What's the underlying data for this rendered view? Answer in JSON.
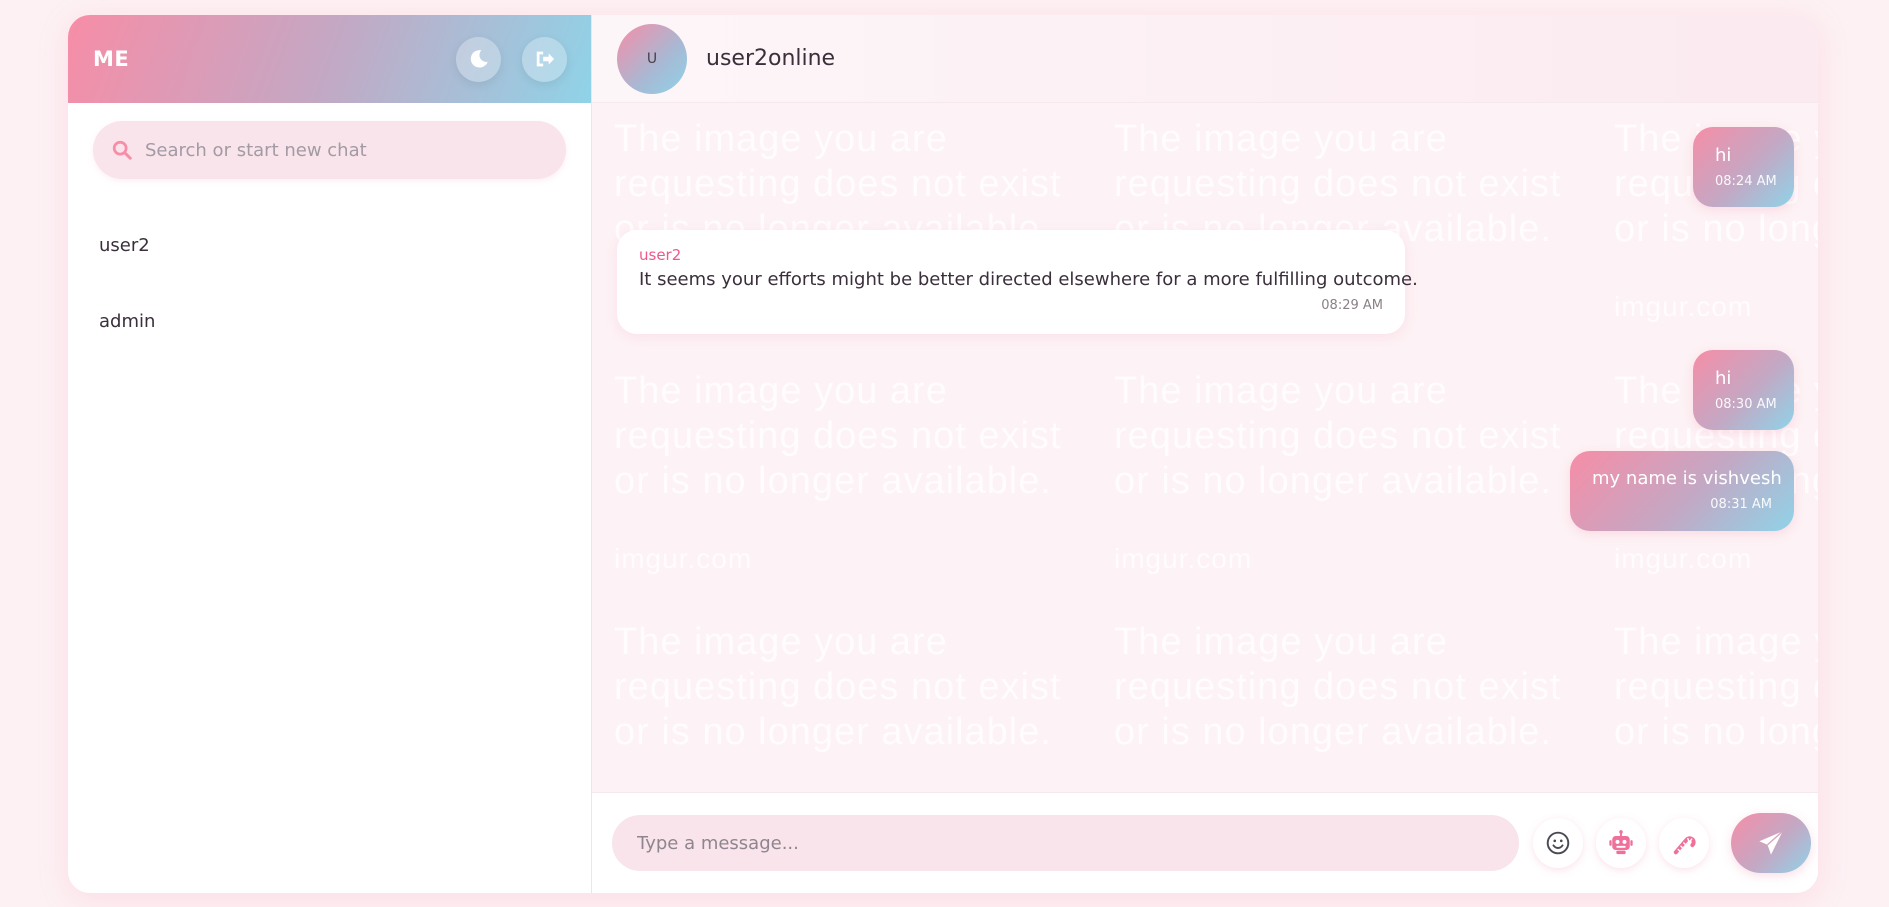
{
  "sidebar": {
    "title": "ME",
    "search_placeholder": "Search or start new chat",
    "chats": [
      {
        "label": "user2"
      },
      {
        "label": "admin"
      }
    ]
  },
  "chat": {
    "avatar_initial": "U",
    "title": "user2online",
    "watermark": {
      "text": "The image you are requesting does not exist or is no longer available.",
      "url": "imgur.com"
    },
    "messages": [
      {
        "direction": "out",
        "text": "hi",
        "time": "08:24 AM"
      },
      {
        "direction": "in",
        "sender": "user2",
        "text": "It seems your efforts might be better directed elsewhere for a more fulfilling outcome.",
        "time": "08:29 AM"
      },
      {
        "direction": "out",
        "text": "hi",
        "time": "08:30 AM"
      },
      {
        "direction": "out",
        "text": "my name is vishvesh",
        "time": "08:31 AM"
      }
    ]
  },
  "composer": {
    "placeholder": "Type a message..."
  },
  "icons": {
    "theme_toggle": "moon-icon",
    "logout": "logout-icon",
    "search": "search-icon",
    "emoji": "smiley-icon",
    "bot": "robot-icon",
    "candy": "candy-cane-icon",
    "send": "paper-plane-icon"
  },
  "colors": {
    "accent_pink": "#f78da7",
    "accent_blue": "#8fd3e8",
    "sender_name": "#f0578a",
    "background": "#fdf1f4"
  }
}
